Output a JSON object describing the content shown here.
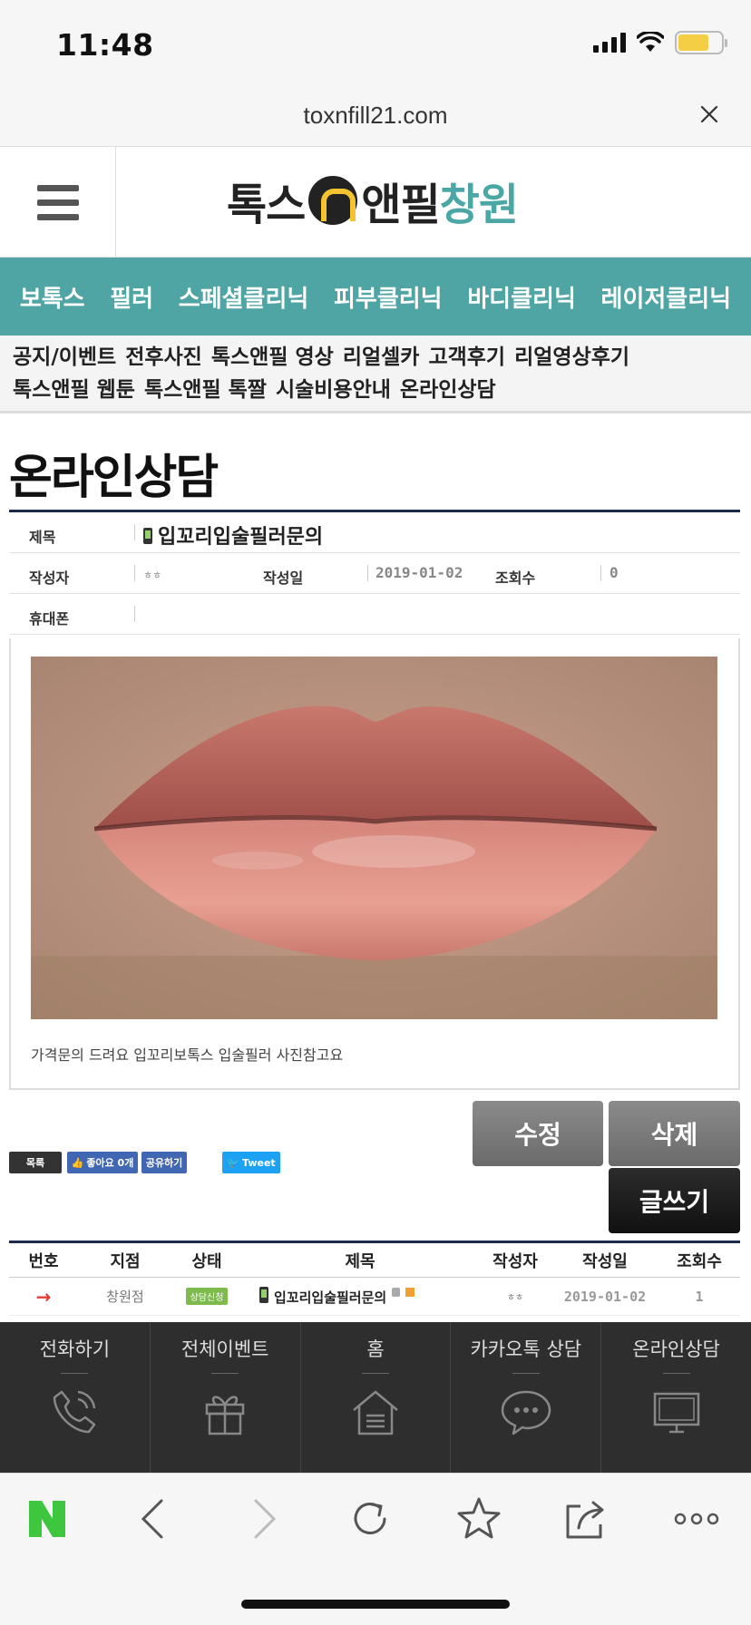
{
  "status": {
    "time": "11:48"
  },
  "browser": {
    "url": "toxnfill21.com"
  },
  "logo": {
    "part1": "톡스",
    "part2": "앤필",
    "part3": "창원"
  },
  "main_nav": [
    "보톡스",
    "필러",
    "스페셜클리닉",
    "피부클리닉",
    "바디클리닉",
    "레이저클리닉"
  ],
  "sub_nav": [
    "공지/이벤트",
    "전후사진",
    "톡스앤필 영상",
    "리얼셀카",
    "고객후기",
    "리얼영상후기",
    "톡스앤필 웹툰",
    "톡스앤필 톡짤",
    "시술비용안내",
    "온라인상담"
  ],
  "page": {
    "title": "온라인상담"
  },
  "post": {
    "label_subject": "제목",
    "subject": "입꼬리입술필러문의",
    "label_author": "작성자",
    "author": "ㅎㅎ",
    "label_date": "작성일",
    "date": "2019-01-02",
    "label_views": "조회수",
    "views": "0",
    "label_phone": "휴대폰",
    "phone": "",
    "body": "가격문의 드려요 입꼬리보톡스 입술필러 사진참고요"
  },
  "buttons": {
    "edit": "수정",
    "delete": "삭제",
    "write": "글쓰기"
  },
  "social": {
    "list": "목록",
    "like": "좋아요 0개",
    "share": "공유하기",
    "tweet": "Tweet"
  },
  "list": {
    "headers": [
      "번호",
      "지점",
      "상태",
      "제목",
      "작성자",
      "작성일",
      "조회수"
    ],
    "rows": [
      {
        "num": "→",
        "branch": "창원점",
        "status": "상담신청",
        "title": "입꼬리입술필러문의",
        "author": "ㅎㅎ",
        "date": "2019-01-02",
        "views": "1"
      }
    ]
  },
  "quick_menu": [
    {
      "label": "전화하기",
      "icon": "phone-icon"
    },
    {
      "label": "전체이벤트",
      "icon": "gift-icon"
    },
    {
      "label": "홈",
      "icon": "home-icon"
    },
    {
      "label": "카카오톡 상담",
      "icon": "chat-icon"
    },
    {
      "label": "온라인상담",
      "icon": "monitor-icon"
    }
  ],
  "toolbar": [
    "naver-icon",
    "back-icon",
    "forward-icon",
    "reload-icon",
    "bookmark-icon",
    "share-icon",
    "more-icon"
  ],
  "colors": {
    "teal": "#4fa5a4",
    "navy": "#1c2b4a",
    "dark": "#2e2e2e",
    "green": "#3ec63e",
    "badge": "#7dbb4c"
  }
}
